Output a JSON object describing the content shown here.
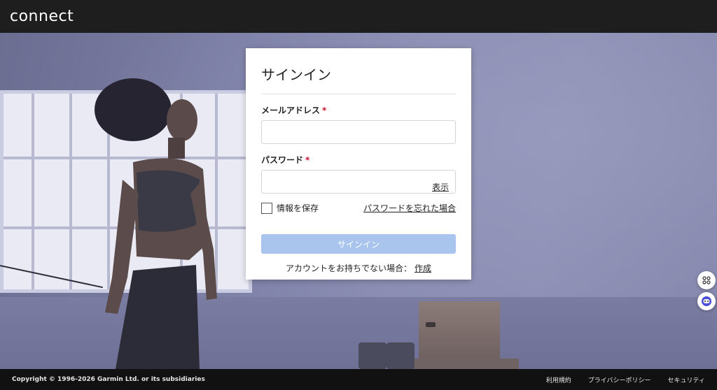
{
  "header": {
    "logo_text": "connect"
  },
  "signin": {
    "title": "サインイン",
    "email_label": "メールアドレス",
    "email_value": "",
    "password_label": "パスワード",
    "password_value": "",
    "required_mark": "*",
    "show_label": "表示",
    "remember_label": "情報を保存",
    "forgot_label": "パスワードを忘れた場合",
    "submit_label": "サインイン",
    "no_account_text": "アカウントをお持ちでない場合：",
    "create_label": "作成"
  },
  "floating": {
    "top_icon": "command-icon",
    "bottom_icon": "chat-bot-icon"
  },
  "footer": {
    "copyright": "Copyright © 1996-2026 Garmin Ltd. or its subsidiaries",
    "links": [
      "利用規約",
      "プライバシーポリシー",
      "セキュリティ"
    ]
  },
  "colors": {
    "topbar": "#1e1e1e",
    "button_disabled": "#a9c5ee",
    "required": "#c8102e",
    "footer": "#111111"
  }
}
